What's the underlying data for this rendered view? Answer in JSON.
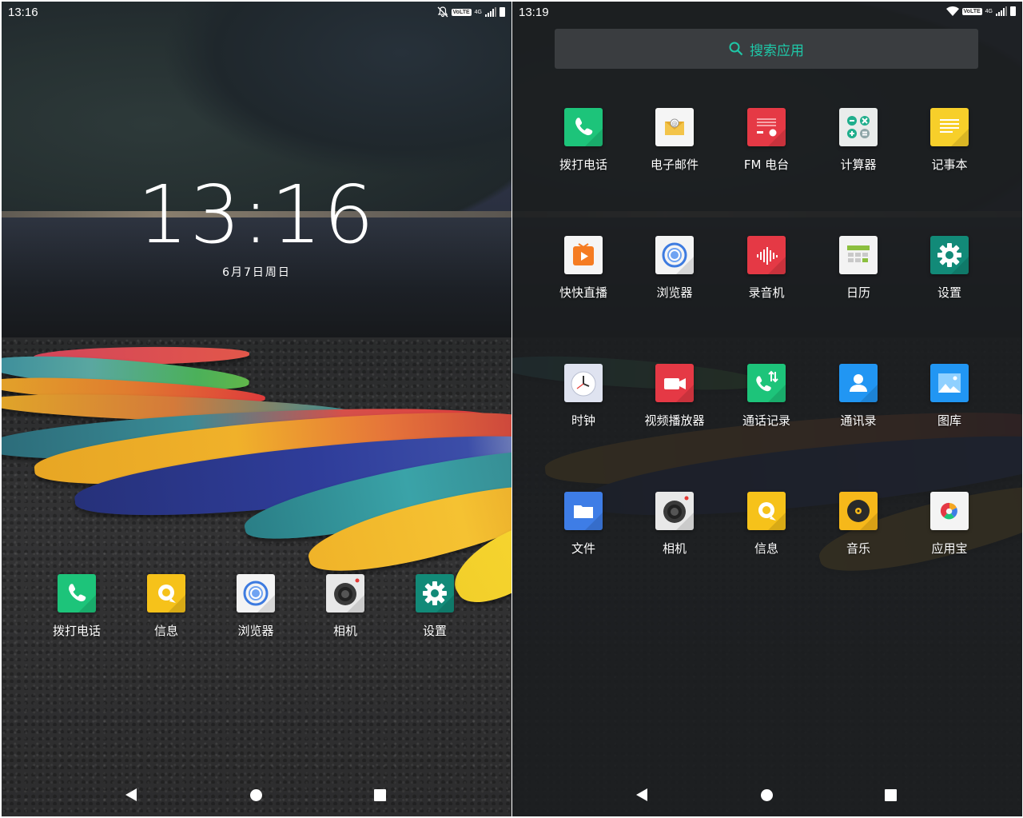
{
  "left_screen": {
    "status": {
      "time": "13:16",
      "volte": "VoLTE",
      "network": "4G"
    },
    "lock": {
      "time": "13:16",
      "date": "6月7日周日"
    },
    "dock": [
      {
        "label": "拨打电话",
        "icon": "phone-icon"
      },
      {
        "label": "信息",
        "icon": "messages-icon"
      },
      {
        "label": "浏览器",
        "icon": "browser-icon"
      },
      {
        "label": "相机",
        "icon": "camera-icon"
      },
      {
        "label": "设置",
        "icon": "settings-gear-icon"
      }
    ]
  },
  "right_screen": {
    "status": {
      "time": "13:19",
      "volte": "VoLTE",
      "network": "4G"
    },
    "search": {
      "label": "搜索应用"
    },
    "apps": [
      {
        "label": "拨打电话",
        "icon": "phone-icon"
      },
      {
        "label": "电子邮件",
        "icon": "email-icon"
      },
      {
        "label": "FM 电台",
        "icon": "radio-icon"
      },
      {
        "label": "计算器",
        "icon": "calculator-icon"
      },
      {
        "label": "记事本",
        "icon": "notepad-icon"
      },
      {
        "label": "快快直播",
        "icon": "live-stream-icon"
      },
      {
        "label": "浏览器",
        "icon": "browser-icon"
      },
      {
        "label": "录音机",
        "icon": "recorder-icon"
      },
      {
        "label": "日历",
        "icon": "calendar-icon"
      },
      {
        "label": "设置",
        "icon": "settings-gear-icon"
      },
      {
        "label": "时钟",
        "icon": "clock-icon"
      },
      {
        "label": "视频播放器",
        "icon": "video-player-icon"
      },
      {
        "label": "通话记录",
        "icon": "call-log-icon"
      },
      {
        "label": "通讯录",
        "icon": "contacts-icon"
      },
      {
        "label": "图库",
        "icon": "gallery-icon"
      },
      {
        "label": "文件",
        "icon": "files-icon"
      },
      {
        "label": "相机",
        "icon": "camera-icon"
      },
      {
        "label": "信息",
        "icon": "messages-icon"
      },
      {
        "label": "音乐",
        "icon": "music-icon"
      },
      {
        "label": "应用宝",
        "icon": "app-store-icon"
      }
    ]
  },
  "colors": {
    "accent": "#1fc7a7",
    "phone_green": "#1dc47a",
    "settings_teal": "#128a78",
    "message_yellow": "#f6c21a"
  }
}
